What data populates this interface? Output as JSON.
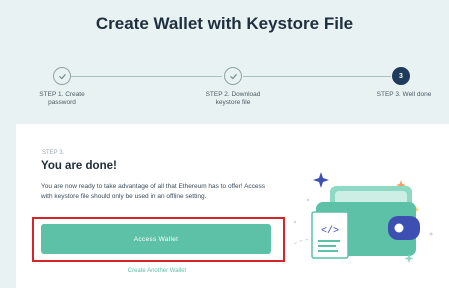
{
  "page": {
    "title": "Create Wallet with Keystore File"
  },
  "steps": [
    {
      "label_line1": "STEP 1. Create",
      "label_line2": "password",
      "status": "done"
    },
    {
      "label_line1": "STEP 2. Download",
      "label_line2": "keystore file",
      "status": "done"
    },
    {
      "label_line1": "STEP 3. Well done",
      "label_line2": "",
      "number": "3",
      "status": "active"
    }
  ],
  "card": {
    "step_label": "STEP 3.",
    "heading": "You are done!",
    "description": "You are now ready to take advantage of all that Ethereum has to offer! Access with keystore file should only be used in an offline setting.",
    "primary_button": "Access Wallet",
    "secondary_link": "Create Another Wallet"
  },
  "colors": {
    "accent": "#5dc1a7",
    "highlight_border": "#d5252b",
    "active_step": "#1e3a5c",
    "background": "#e9f2f2"
  },
  "icons": [
    "check-icon",
    "check-icon",
    "wallet-illustration"
  ]
}
